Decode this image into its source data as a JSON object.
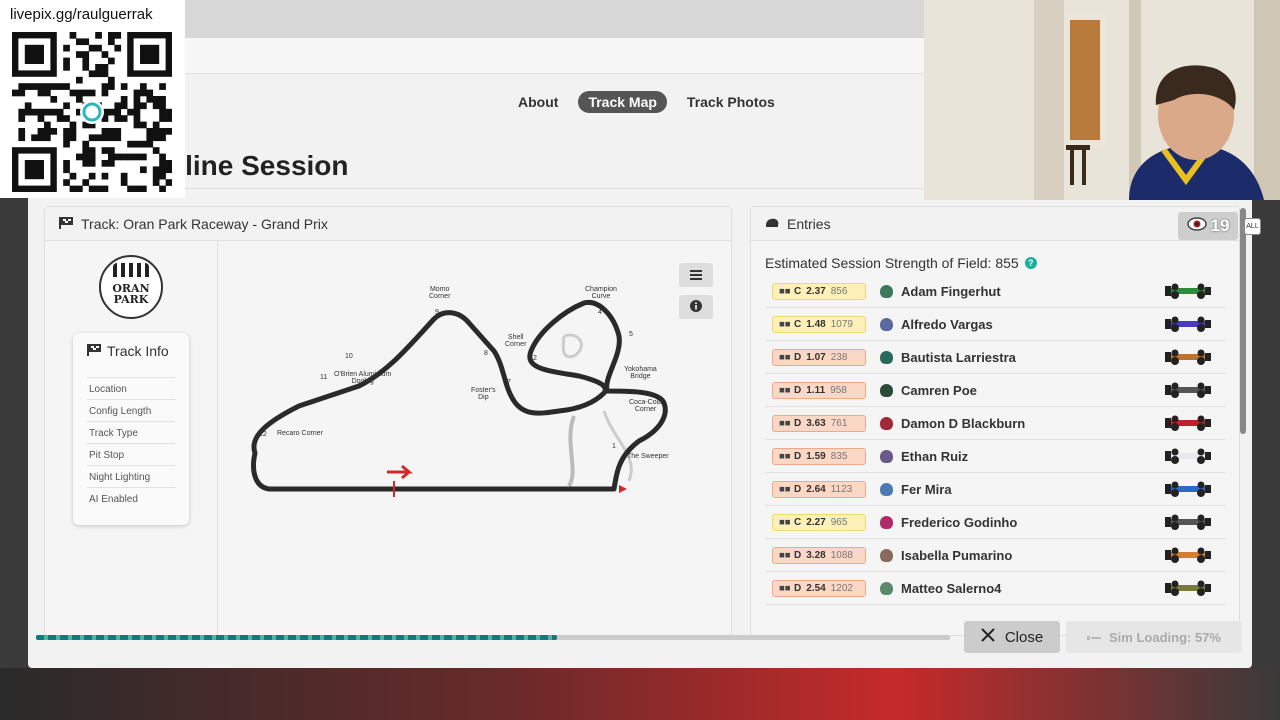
{
  "overlay": {
    "stream_url": "livepix.gg/raulguerrak",
    "viewer_count": "19",
    "all_label": "ALL"
  },
  "nav": {
    "about": "About",
    "track_map": "Track Map",
    "track_photos": "Track Photos"
  },
  "session_title": "nline Session",
  "track_panel": {
    "header": "Track: Oran Park Raceway - Grand Prix",
    "logo_line1": "ORAN",
    "logo_line2": "PARK",
    "info_title": "Track Info",
    "info_items": [
      "Location",
      "Config Length",
      "Track Type",
      "Pit Stop",
      "Night Lighting",
      "AI Enabled"
    ]
  },
  "map": {
    "labels": {
      "momo": "Momo",
      "momo2": "Corner",
      "champion": "Champion",
      "champion2": "Curve",
      "shell": "Shell",
      "shell2": "Corner",
      "yokohama": "Yokohama",
      "yokohama2": "Bridge",
      "obrien": "O'Brien Aluminium",
      "obrien2": "Dogleg",
      "fosters": "Foster's",
      "fosters2": "Dip",
      "cocacola": "Coca-Cola",
      "cocacola2": "Corner",
      "recaro": "Recaro Corner",
      "sweeper": "The Sweeper"
    },
    "turns": [
      "1",
      "2",
      "4",
      "5",
      "6",
      "7",
      "8",
      "9",
      "10",
      "11",
      "12"
    ]
  },
  "entries": {
    "header": "Entries",
    "sof_label": "Estimated Session Strength of Field: 855",
    "help": "?",
    "rows": [
      {
        "cls": "C",
        "sr": "2.37",
        "ir": "856",
        "name": "Adam Fingerhut",
        "helmet": "#3a7a5a",
        "car": "#2f8a3a"
      },
      {
        "cls": "C",
        "sr": "1.48",
        "ir": "1079",
        "name": "Alfredo Vargas",
        "helmet": "#5a6aa0",
        "car": "#4a3ac0"
      },
      {
        "cls": "D",
        "sr": "1.07",
        "ir": "238",
        "name": "Bautista Larriestra",
        "helmet": "#2a6a5a",
        "car": "#c0702a"
      },
      {
        "cls": "D",
        "sr": "1.11",
        "ir": "958",
        "name": "Camren Poe",
        "helmet": "#2a4a3a",
        "car": "#555555"
      },
      {
        "cls": "D",
        "sr": "3.63",
        "ir": "761",
        "name": "Damon D Blackburn",
        "helmet": "#a02a3a",
        "car": "#c0202a"
      },
      {
        "cls": "D",
        "sr": "1.59",
        "ir": "835",
        "name": "Ethan Ruiz",
        "helmet": "#6a5a8a",
        "car": "#e8e8f0"
      },
      {
        "cls": "D",
        "sr": "2.64",
        "ir": "1123",
        "name": "Fer Mira",
        "helmet": "#4a7ab0",
        "car": "#2a6ac0"
      },
      {
        "cls": "C",
        "sr": "2.27",
        "ir": "965",
        "name": "Frederico Godinho",
        "helmet": "#b02a6a",
        "car": "#555555"
      },
      {
        "cls": "D",
        "sr": "3.28",
        "ir": "1088",
        "name": "Isabella Pumarino",
        "helmet": "#8a6a5a",
        "car": "#d08030"
      },
      {
        "cls": "D",
        "sr": "2.54",
        "ir": "1202",
        "name": "Matteo Salerno4",
        "helmet": "#5a8a6a",
        "car": "#7a7a3a"
      }
    ]
  },
  "footer": {
    "progress": 0.57,
    "close": "Close",
    "sim_loading": "Sim Loading: 57%"
  }
}
